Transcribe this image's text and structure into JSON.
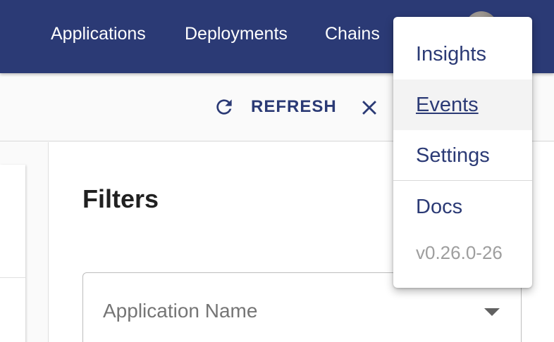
{
  "header": {
    "nav": [
      "Applications",
      "Deployments",
      "Chains"
    ],
    "avatar_alt": "user-avatar"
  },
  "toolbar": {
    "refresh_label": "REFRESH"
  },
  "filters": {
    "title": "Filters",
    "application_name_placeholder": "Application Name"
  },
  "menu": {
    "items": [
      "Insights",
      "Events",
      "Settings"
    ],
    "docs": "Docs",
    "version": "v0.26.0-26"
  },
  "colors": {
    "brand": "#2b3a75",
    "menu_hover": "#f3f3f3"
  }
}
